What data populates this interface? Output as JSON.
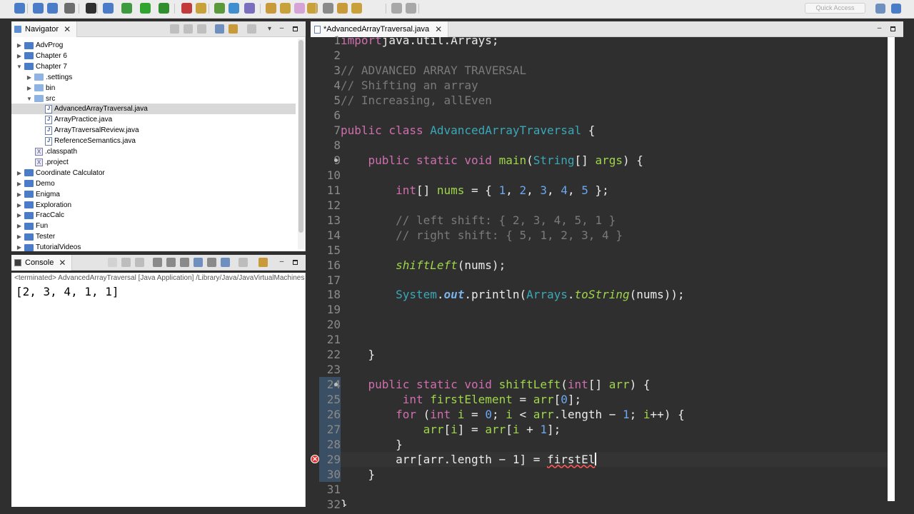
{
  "toolbar": {
    "quick_access_placeholder": "Quick Access",
    "icons": [
      "new-icon",
      "save-icon",
      "save-all-icon",
      "print-icon",
      "debug-perspective-icon",
      "skip-breakpoints-icon",
      "debug-icon",
      "run-icon",
      "coverage-icon",
      "run-last-icon",
      "new-java-project-icon",
      "new-package-icon",
      "new-class-icon",
      "open-type-icon",
      "open-task-icon",
      "search-icon",
      "annotation-icon",
      "mark-occurrences-icon",
      "show-whitespace-icon",
      "next-annotation-icon",
      "prev-annotation-icon",
      "back-icon",
      "forward-icon"
    ]
  },
  "navigator": {
    "title": "Navigator",
    "items": [
      {
        "label": "AdvProg",
        "kind": "project",
        "expanded": false,
        "depth": 0
      },
      {
        "label": "Chapter 6",
        "kind": "project",
        "expanded": false,
        "depth": 0
      },
      {
        "label": "Chapter 7",
        "kind": "project",
        "expanded": true,
        "depth": 0
      },
      {
        "label": ".settings",
        "kind": "folder",
        "expanded": false,
        "depth": 1
      },
      {
        "label": "bin",
        "kind": "folder",
        "expanded": false,
        "depth": 1
      },
      {
        "label": "src",
        "kind": "folder",
        "expanded": true,
        "depth": 1
      },
      {
        "label": "AdvancedArrayTraversal.java",
        "kind": "java",
        "selected": true,
        "depth": 2
      },
      {
        "label": "ArrayPractice.java",
        "kind": "java",
        "depth": 2
      },
      {
        "label": "ArrayTraversalReview.java",
        "kind": "java",
        "depth": 2
      },
      {
        "label": "ReferenceSemantics.java",
        "kind": "java",
        "depth": 2
      },
      {
        "label": ".classpath",
        "kind": "xfile",
        "depth": 1
      },
      {
        "label": ".project",
        "kind": "xfile",
        "depth": 1
      },
      {
        "label": "Coordinate Calculator",
        "kind": "project",
        "expanded": false,
        "depth": 0
      },
      {
        "label": "Demo",
        "kind": "project",
        "expanded": false,
        "depth": 0
      },
      {
        "label": "Enigma",
        "kind": "project",
        "expanded": false,
        "depth": 0
      },
      {
        "label": "Exploration",
        "kind": "project",
        "expanded": false,
        "depth": 0
      },
      {
        "label": "FracCalc",
        "kind": "project",
        "expanded": false,
        "depth": 0
      },
      {
        "label": "Fun",
        "kind": "project",
        "expanded": false,
        "depth": 0
      },
      {
        "label": "Tester",
        "kind": "project",
        "expanded": false,
        "depth": 0
      },
      {
        "label": "TutorialVideos",
        "kind": "project",
        "expanded": false,
        "depth": 0
      }
    ]
  },
  "console": {
    "title": "Console",
    "description": "<terminated> AdvancedArrayTraversal [Java Application] /Library/Java/JavaVirtualMachines/",
    "output": "[2, 3, 4, 1, 1]"
  },
  "editor": {
    "tab_label": "*AdvancedArrayTraversal.java",
    "current_line": 29,
    "error_line": 29,
    "lines": [
      {
        "n": 1,
        "tokens": [
          [
            "kw",
            "import"
          ],
          [
            "",
            "java.util.Arrays;"
          ]
        ]
      },
      {
        "n": 2,
        "tokens": []
      },
      {
        "n": 3,
        "tokens": [
          [
            "cm",
            "// ADVANCED ARRAY TRAVERSAL"
          ]
        ]
      },
      {
        "n": 4,
        "tokens": [
          [
            "cm",
            "// Shifting an array"
          ]
        ]
      },
      {
        "n": 5,
        "tokens": [
          [
            "cm",
            "// Increasing, allEven"
          ]
        ]
      },
      {
        "n": 6,
        "tokens": []
      },
      {
        "n": 7,
        "tokens": [
          [
            "kw",
            "public class "
          ],
          [
            "ty",
            "AdvancedArrayTraversal"
          ],
          [
            "",
            " {"
          ]
        ]
      },
      {
        "n": 8,
        "tokens": []
      },
      {
        "n": 9,
        "tokens": [
          [
            "",
            "    "
          ],
          [
            "kw",
            "public static void "
          ],
          [
            "fn",
            "main"
          ],
          [
            "",
            "("
          ],
          [
            "ty",
            "String"
          ],
          [
            "",
            "[] "
          ],
          [
            "fn",
            "args"
          ],
          [
            "",
            ") {"
          ]
        ]
      },
      {
        "n": 10,
        "tokens": []
      },
      {
        "n": 11,
        "tokens": [
          [
            "",
            "        "
          ],
          [
            "kw",
            "int"
          ],
          [
            "",
            "[] "
          ],
          [
            "fn",
            "nums"
          ],
          [
            "",
            " = { "
          ],
          [
            "nb",
            "1"
          ],
          [
            "",
            ", "
          ],
          [
            "nb",
            "2"
          ],
          [
            "",
            ", "
          ],
          [
            "nb",
            "3"
          ],
          [
            "",
            ", "
          ],
          [
            "nb",
            "4"
          ],
          [
            "",
            ", "
          ],
          [
            "nb",
            "5"
          ],
          [
            "",
            " };"
          ]
        ]
      },
      {
        "n": 12,
        "tokens": []
      },
      {
        "n": 13,
        "tokens": [
          [
            "",
            "        "
          ],
          [
            "cm",
            "// left shift: { 2, 3, 4, 5, 1 }"
          ]
        ]
      },
      {
        "n": 14,
        "tokens": [
          [
            "",
            "        "
          ],
          [
            "cm",
            "// right shift: { 5, 1, 2, 3, 4 }"
          ]
        ]
      },
      {
        "n": 15,
        "tokens": []
      },
      {
        "n": 16,
        "tokens": [
          [
            "",
            "        "
          ],
          [
            "it",
            "shiftLeft"
          ],
          [
            "",
            "(nums);"
          ]
        ]
      },
      {
        "n": 17,
        "tokens": []
      },
      {
        "n": 18,
        "tokens": [
          [
            "",
            "        "
          ],
          [
            "ty",
            "System"
          ],
          [
            "",
            "."
          ],
          [
            "st",
            "out"
          ],
          [
            "",
            ".println("
          ],
          [
            "ty",
            "Arrays"
          ],
          [
            "",
            "."
          ],
          [
            "it",
            "toString"
          ],
          [
            "",
            "(nums));"
          ]
        ]
      },
      {
        "n": 19,
        "tokens": []
      },
      {
        "n": 20,
        "tokens": []
      },
      {
        "n": 21,
        "tokens": []
      },
      {
        "n": 22,
        "tokens": [
          [
            "",
            "    }"
          ]
        ]
      },
      {
        "n": 23,
        "tokens": []
      },
      {
        "n": 24,
        "tokens": [
          [
            "",
            "    "
          ],
          [
            "kw",
            "public static void "
          ],
          [
            "fn",
            "shiftLeft"
          ],
          [
            "",
            "("
          ],
          [
            "kw",
            "int"
          ],
          [
            "",
            "[] "
          ],
          [
            "fn",
            "arr"
          ],
          [
            "",
            ") {"
          ]
        ]
      },
      {
        "n": 25,
        "tokens": [
          [
            "",
            "         "
          ],
          [
            "kw",
            "int "
          ],
          [
            "fn",
            "firstElement"
          ],
          [
            "",
            " = "
          ],
          [
            "fn",
            "arr"
          ],
          [
            "",
            "["
          ],
          [
            "nb",
            "0"
          ],
          [
            "",
            "];"
          ]
        ]
      },
      {
        "n": 26,
        "tokens": [
          [
            "",
            "        "
          ],
          [
            "kw",
            "for"
          ],
          [
            "",
            " ("
          ],
          [
            "kw",
            "int "
          ],
          [
            "fn",
            "i"
          ],
          [
            "",
            " = "
          ],
          [
            "nb",
            "0"
          ],
          [
            "",
            "; "
          ],
          [
            "fn",
            "i"
          ],
          [
            "",
            " < "
          ],
          [
            "fn",
            "arr"
          ],
          [
            "",
            ".length − "
          ],
          [
            "nb",
            "1"
          ],
          [
            "",
            "; "
          ],
          [
            "fn",
            "i"
          ],
          [
            "",
            "++) {"
          ]
        ]
      },
      {
        "n": 27,
        "tokens": [
          [
            "",
            "            "
          ],
          [
            "fn",
            "arr"
          ],
          [
            "",
            "["
          ],
          [
            "fn",
            "i"
          ],
          [
            "",
            "] = "
          ],
          [
            "fn",
            "arr"
          ],
          [
            "",
            "["
          ],
          [
            "fn",
            "i"
          ],
          [
            "",
            " + "
          ],
          [
            "nb",
            "1"
          ],
          [
            "",
            "];"
          ]
        ]
      },
      {
        "n": 28,
        "tokens": [
          [
            "",
            "        }"
          ]
        ]
      },
      {
        "n": 29,
        "tokens": [
          [
            "",
            "        arr[arr.length − 1] = "
          ],
          [
            "err",
            "firstEl"
          ]
        ],
        "caret": true
      },
      {
        "n": 30,
        "tokens": [
          [
            "",
            "    }"
          ]
        ]
      },
      {
        "n": 31,
        "tokens": []
      },
      {
        "n": 32,
        "tokens": [
          [
            "",
            "}"
          ]
        ]
      }
    ]
  },
  "colors": {
    "editor_bg": "#2f2f2f",
    "keyword": "#d06fae",
    "comment": "#7a7a7a",
    "number": "#6ba8ef",
    "type": "#3aa8b8",
    "identifier": "#9fd64a",
    "error": "#e03131"
  }
}
